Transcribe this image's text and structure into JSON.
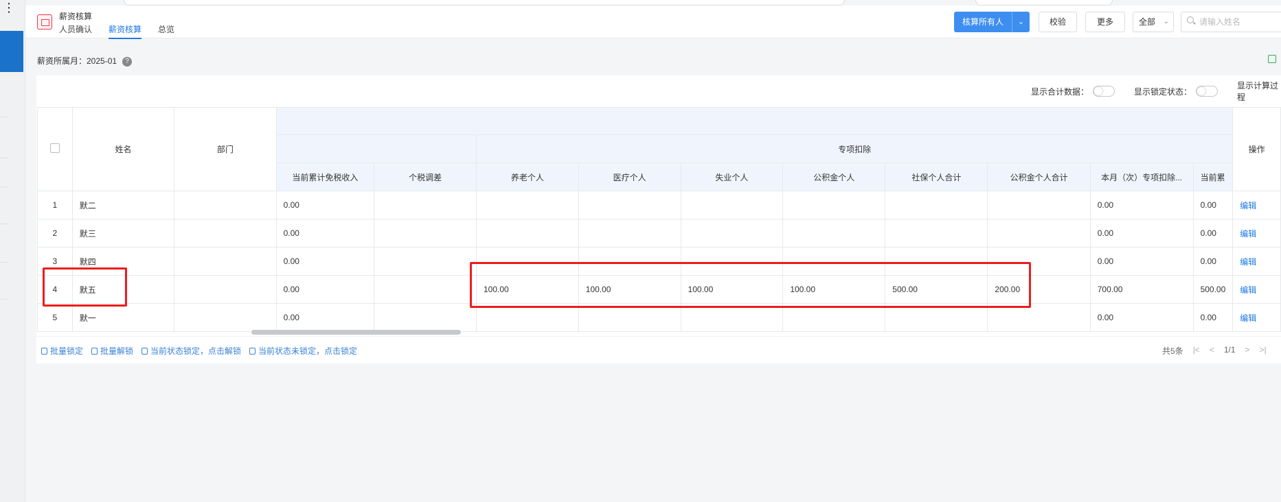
{
  "app": {
    "title": "薪资核算",
    "tabs": [
      {
        "label": "人员确认",
        "active": false
      },
      {
        "label": "薪资核算",
        "active": true
      },
      {
        "label": "总览",
        "active": false
      }
    ]
  },
  "toolbar": {
    "primary_label": "核算所有人",
    "verify_label": "校验",
    "more_label": "更多",
    "filter_value": "全部",
    "search_placeholder": "请输入姓名"
  },
  "month": {
    "label": "薪资所属月：2025-01"
  },
  "toggles": [
    {
      "label": "显示合计数据：",
      "on": false
    },
    {
      "label": "显示锁定状态：",
      "on": false
    },
    {
      "label": "显示计算过程",
      "on": false
    }
  ],
  "table": {
    "headers": {
      "name": "姓名",
      "dept": "部门",
      "group": "专项扣除",
      "action": "操作",
      "cols": [
        "当前累计免税收入",
        "个税调差",
        "养老个人",
        "医疗个人",
        "失业个人",
        "公积金个人",
        "社保个人合计",
        "公积金个人合计",
        "本月（次）专项扣除...",
        "当前累"
      ]
    },
    "rows": [
      {
        "idx": "1",
        "name": "默二",
        "dept": "",
        "cells": [
          "0.00",
          "",
          "",
          "",
          "",
          "",
          "",
          "",
          "0.00",
          "0.00"
        ],
        "action": "编辑"
      },
      {
        "idx": "2",
        "name": "默三",
        "dept": "",
        "cells": [
          "0.00",
          "",
          "",
          "",
          "",
          "",
          "",
          "",
          "0.00",
          "0.00"
        ],
        "action": "编辑"
      },
      {
        "idx": "3",
        "name": "默四",
        "dept": "",
        "cells": [
          "0.00",
          "",
          "",
          "",
          "",
          "",
          "",
          "",
          "0.00",
          "0.00"
        ],
        "action": "编辑"
      },
      {
        "idx": "4",
        "name": "默五",
        "dept": "",
        "cells": [
          "0.00",
          "",
          "100.00",
          "100.00",
          "100.00",
          "100.00",
          "500.00",
          "200.00",
          "700.00",
          "500.00"
        ],
        "action": "编辑"
      },
      {
        "idx": "5",
        "name": "默一",
        "dept": "",
        "cells": [
          "0.00",
          "",
          "",
          "",
          "",
          "",
          "",
          "",
          "0.00",
          "0.00"
        ],
        "action": "编辑"
      }
    ]
  },
  "footer": {
    "actions": [
      "批量锁定",
      "批量解锁",
      "当前状态锁定，点击解锁",
      "当前状态未锁定，点击锁定"
    ],
    "total": "共5条",
    "page": "1/1"
  },
  "colors": {
    "primary": "#3d8ef0",
    "link": "#1e7ae6",
    "highlight": "#ee1c1c",
    "header_blue": "#f0f5fd"
  }
}
